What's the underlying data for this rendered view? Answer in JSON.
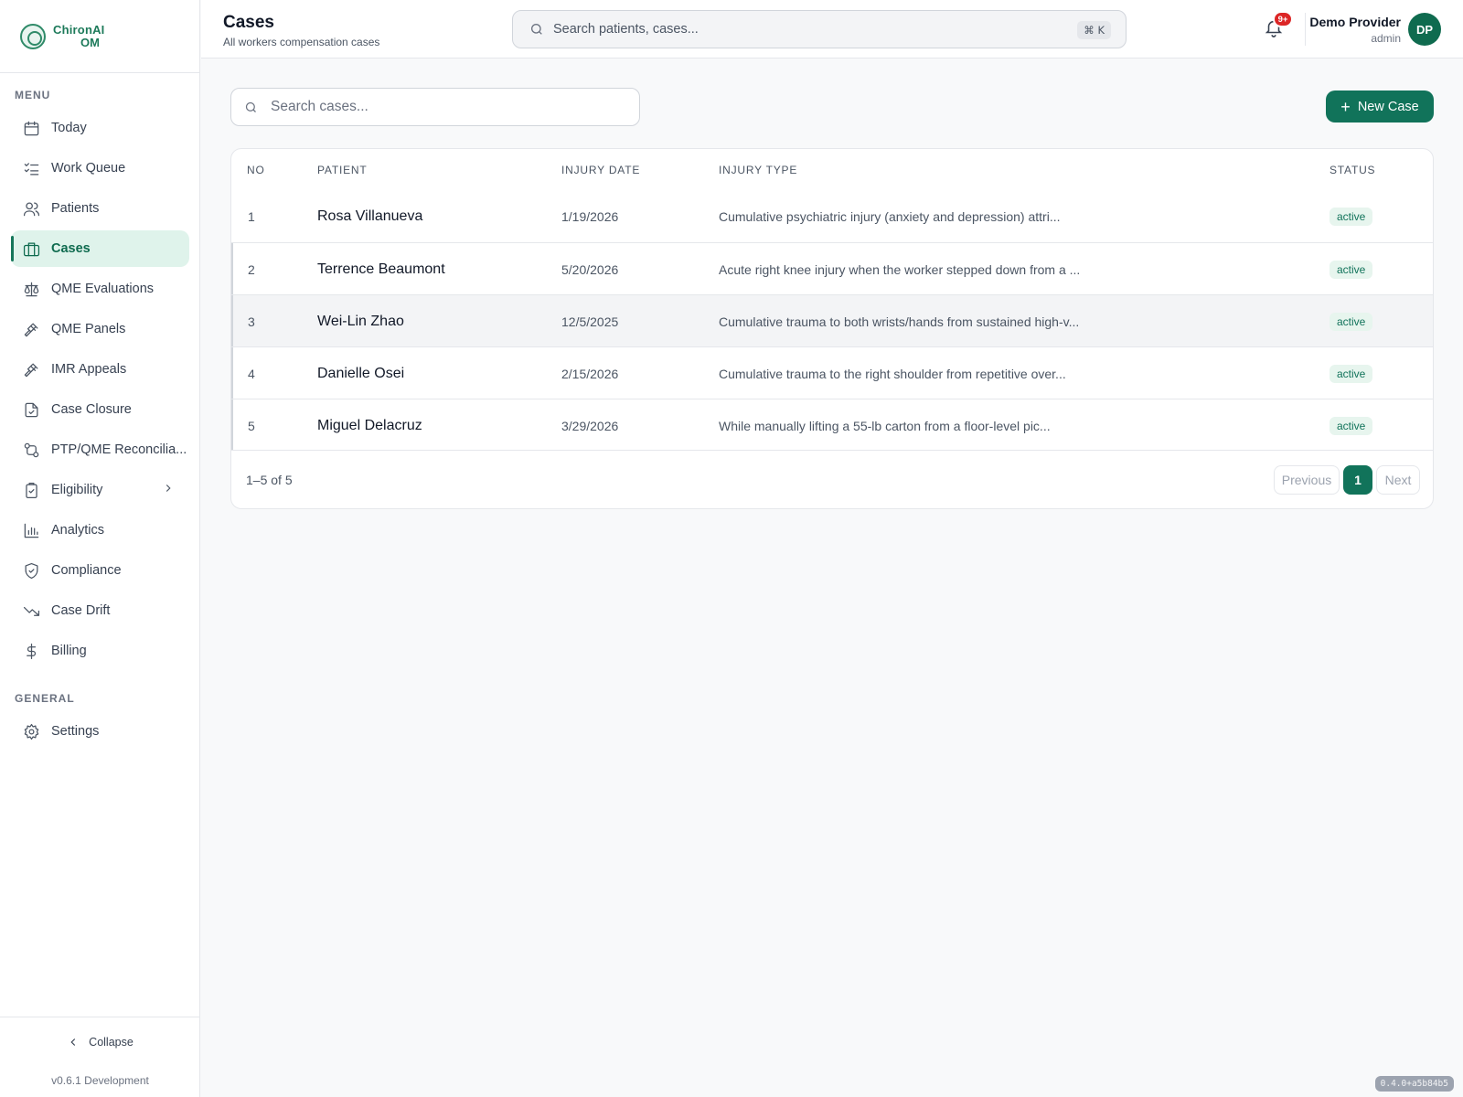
{
  "brand": {
    "name": "ChironAI",
    "sub": "OM"
  },
  "sidebar": {
    "menu_label": "MENU",
    "general_label": "GENERAL",
    "items": [
      {
        "label": "Today",
        "icon": "calendar-icon"
      },
      {
        "label": "Work Queue",
        "icon": "list-checks-icon"
      },
      {
        "label": "Patients",
        "icon": "users-icon"
      },
      {
        "label": "Cases",
        "icon": "briefcase-icon",
        "active": true
      },
      {
        "label": "QME Evaluations",
        "icon": "scale-icon"
      },
      {
        "label": "QME Panels",
        "icon": "gavel-icon"
      },
      {
        "label": "IMR Appeals",
        "icon": "gavel-icon"
      },
      {
        "label": "Case Closure",
        "icon": "file-check-icon"
      },
      {
        "label": "PTP/QME Reconcilia...",
        "icon": "git-compare-icon"
      },
      {
        "label": "Eligibility",
        "icon": "clipboard-check-icon",
        "has_submenu": true
      },
      {
        "label": "Analytics",
        "icon": "bar-chart-icon"
      },
      {
        "label": "Compliance",
        "icon": "shield-check-icon"
      },
      {
        "label": "Case Drift",
        "icon": "trending-down-icon"
      },
      {
        "label": "Billing",
        "icon": "dollar-icon"
      }
    ],
    "general_items": [
      {
        "label": "Settings",
        "icon": "gear-icon"
      }
    ],
    "collapse_label": "Collapse",
    "version": "v0.6.1 Development"
  },
  "header": {
    "title": "Cases",
    "subtitle": "All workers compensation cases",
    "search_placeholder": "Search patients, cases...",
    "shortcut": "⌘ K",
    "notification_badge": "9+",
    "user_name": "Demo Provider",
    "user_role": "admin",
    "avatar_initials": "DP"
  },
  "main": {
    "search_placeholder": "Search cases...",
    "new_case_label": "New Case",
    "columns": {
      "no": "NO",
      "patient": "PATIENT",
      "injury_date": "INJURY DATE",
      "injury_type": "INJURY TYPE",
      "status": "STATUS"
    },
    "rows": [
      {
        "no": "1",
        "patient": "Rosa Villanueva",
        "injury_date": "1/19/2026",
        "injury_type": "Cumulative psychiatric injury (anxiety and depression) attri...",
        "status": "active"
      },
      {
        "no": "2",
        "patient": "Terrence Beaumont",
        "injury_date": "5/20/2026",
        "injury_type": "Acute right knee injury when the worker stepped down from a ...",
        "status": "active"
      },
      {
        "no": "3",
        "patient": "Wei-Lin Zhao",
        "injury_date": "12/5/2025",
        "injury_type": "Cumulative trauma to both wrists/hands from sustained high-v...",
        "status": "active"
      },
      {
        "no": "4",
        "patient": "Danielle Osei",
        "injury_date": "2/15/2026",
        "injury_type": "Cumulative trauma to the right shoulder from repetitive over...",
        "status": "active"
      },
      {
        "no": "5",
        "patient": "Miguel Delacruz",
        "injury_date": "3/29/2026",
        "injury_type": "While manually lifting a 55-lb carton from a floor-level pic...",
        "status": "active"
      }
    ],
    "pagination": {
      "range": "1–5 of 5",
      "previous": "Previous",
      "current_page": "1",
      "next": "Next"
    }
  },
  "build_tag": "0.4.0+a5b84b5",
  "colors": {
    "accent": "#11735a",
    "active_bg": "#dff3eb",
    "badge": "#dc2626"
  }
}
